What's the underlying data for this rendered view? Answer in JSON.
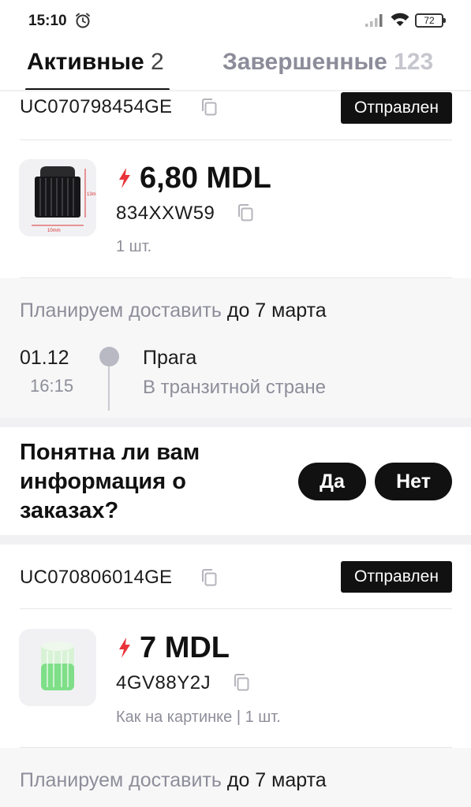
{
  "status_bar": {
    "time": "15:10",
    "battery": "72"
  },
  "tabs": [
    {
      "label": "Активные",
      "count": "2"
    },
    {
      "label": "Завершенные",
      "count": "123"
    }
  ],
  "orders": [
    {
      "tracking": "UC070798454GE",
      "status": "Отправлен",
      "price": "6,80 MDL",
      "sku": "834XXW59",
      "qty": "1 шт.",
      "plan_prefix": "Планируем доставить",
      "plan_date": "до 7 марта",
      "event": {
        "date": "01.12",
        "time": "16:15",
        "city": "Прага",
        "status": "В транзитной стране"
      }
    },
    {
      "tracking": "UC070806014GE",
      "status": "Отправлен",
      "price": "7 MDL",
      "sku": "4GV88Y2J",
      "qty": "Как на картинке | 1 шт.",
      "plan_prefix": "Планируем доставить",
      "plan_date": "до 7 марта"
    }
  ],
  "feedback": {
    "question": "Понятна ли вам информация о заказах?",
    "yes": "Да",
    "no": "Нет"
  },
  "product_thumb_1": {
    "dim_height": "13mm",
    "dim_width": "10mm"
  },
  "colors": {
    "accent_bolt": "#e8343a",
    "badge_bg": "#111111",
    "muted_text": "#8e8e9a"
  }
}
